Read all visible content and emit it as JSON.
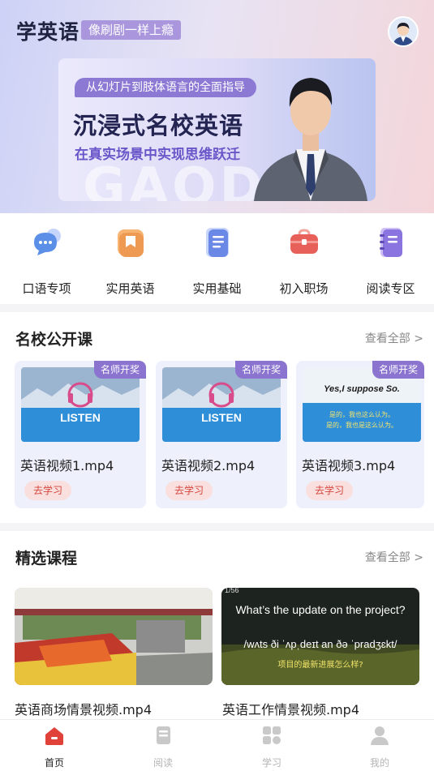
{
  "header": {
    "app_title": "学英语",
    "slogan": "像刷剧一样上瘾"
  },
  "banner": {
    "subtitle": "从幻灯片到肢体语言的全面指导",
    "title": "沉浸式名校英语",
    "tagline": "在真实场景中实现思维跃迁",
    "watermark": "GAOD"
  },
  "quick_nav": [
    {
      "label": "口语专项",
      "icon": "speech-bubble-icon",
      "color": "#5b8fe8"
    },
    {
      "label": "实用英语",
      "icon": "bookmark-icon",
      "color": "#f0a05a"
    },
    {
      "label": "实用基础",
      "icon": "document-icon",
      "color": "#6a88e6"
    },
    {
      "label": "初入职场",
      "icon": "briefcase-icon",
      "color": "#e8605a"
    },
    {
      "label": "阅读专区",
      "icon": "notebook-icon",
      "color": "#8a74e0"
    }
  ],
  "open_courses": {
    "title": "名校公开课",
    "more": "查看全部 >",
    "items": [
      {
        "badge": "名师开奖",
        "title": "英语视频1.mp4",
        "button": "去学习",
        "thumb_text": "LISTEN"
      },
      {
        "badge": "名师开奖",
        "title": "英语视频2.mp4",
        "button": "去学习",
        "thumb_text": "LISTEN"
      },
      {
        "badge": "名师开奖",
        "title": "英语视频3.mp4",
        "button": "去学习",
        "thumb_text": "Yes,I suppose So.",
        "thumb_cn1": "是的，我也这么认为。",
        "thumb_cn2": "是的，我也是这么认为。"
      }
    ]
  },
  "selected_courses": {
    "title": "精选课程",
    "more": "查看全部 >",
    "items": [
      {
        "title": "英语商场情景视频.mp4"
      },
      {
        "title": "英语工作情景视频.mp4",
        "overlay_en": "What’s the update on the project?",
        "overlay_ipa": "/wʌts ði ˈʌpˌdeɪt an ðə ˈpradʒɛkt/",
        "overlay_cn": "项目的最新进展怎么样?",
        "overlay_time": "1/56"
      }
    ]
  },
  "tabbar": [
    {
      "label": "首页",
      "icon": "home-icon",
      "active": true
    },
    {
      "label": "阅读",
      "icon": "book-icon",
      "active": false
    },
    {
      "label": "学习",
      "icon": "grid-icon",
      "active": false
    },
    {
      "label": "我的",
      "icon": "user-icon",
      "active": false
    }
  ],
  "colors": {
    "accent": "#8a74cf",
    "active_tab": "#e0423a",
    "button_bg": "#f9e0df",
    "button_text": "#d6453d"
  }
}
